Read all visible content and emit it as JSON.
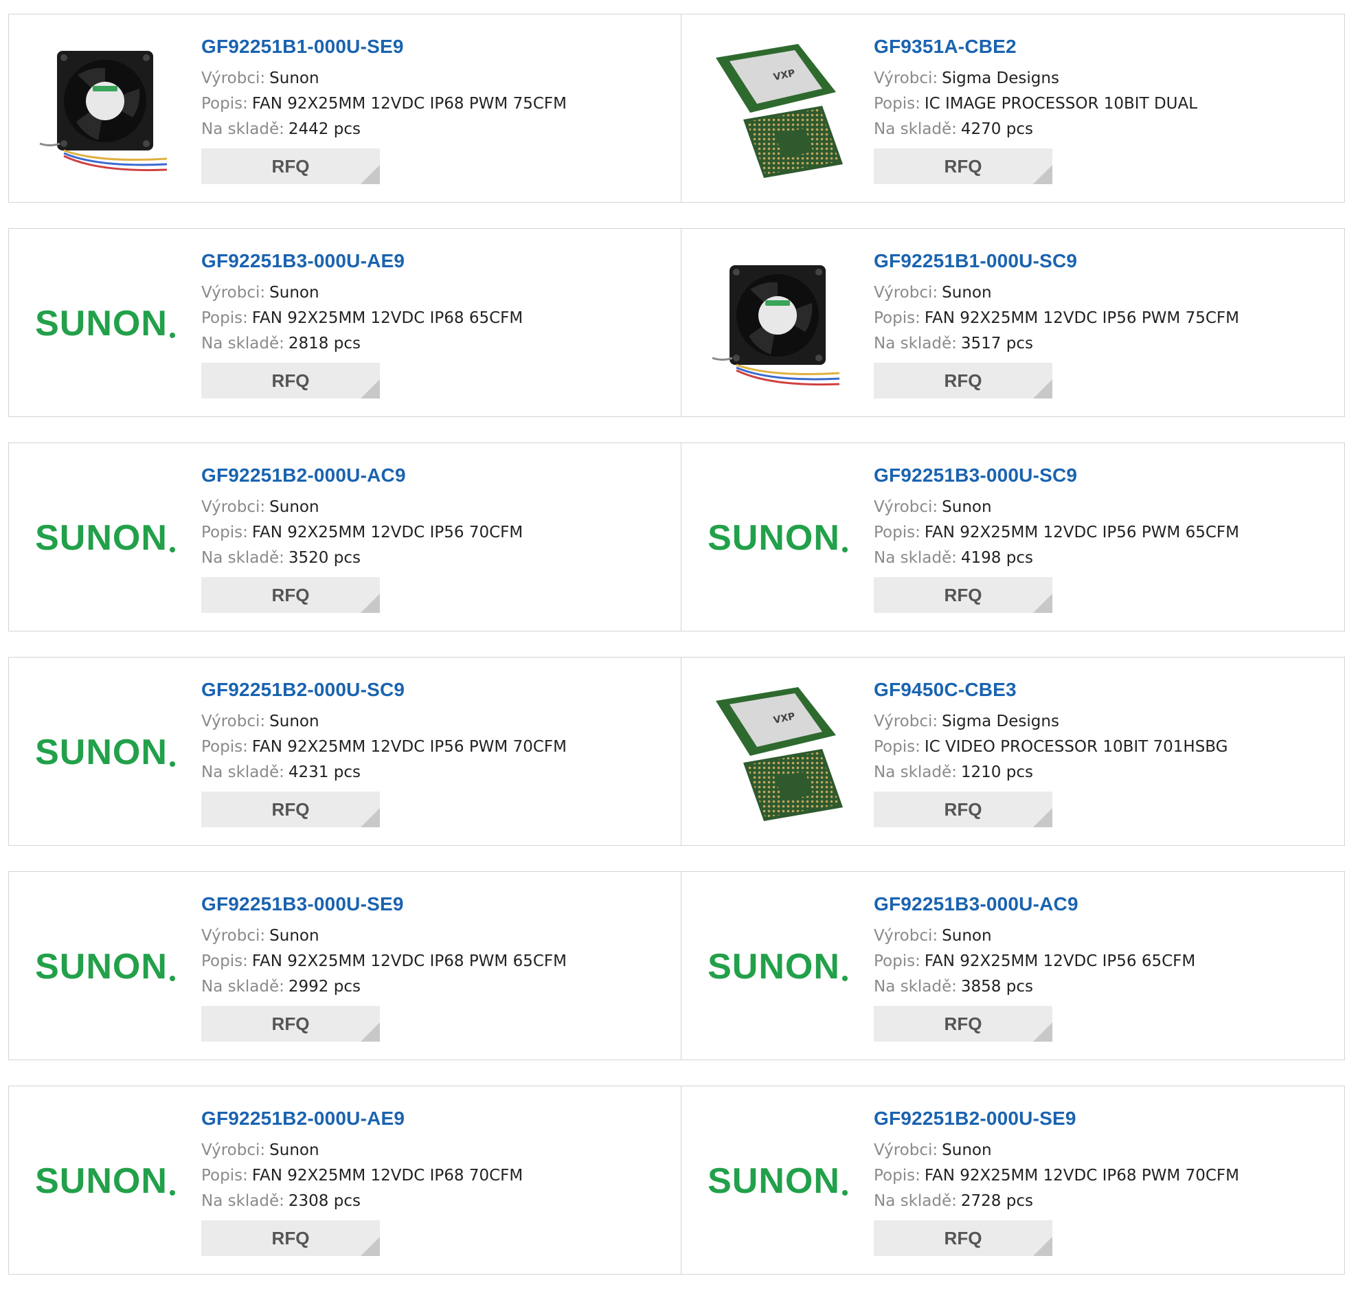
{
  "labels": {
    "manufacturer": "Výrobci:",
    "description": "Popis:",
    "stock": "Na skladě:",
    "rfq": "RFQ"
  },
  "brand_text": "SUNON",
  "products": [
    {
      "part": "GF92251B1-000U-SE9",
      "manufacturer": "Sunon",
      "description": "FAN 92X25MM 12VDC IP68 PWM 75CFM",
      "stock": "2442 pcs",
      "image": "fan"
    },
    {
      "part": "GF9351A-CBE2",
      "manufacturer": "Sigma Designs",
      "description": "IC IMAGE PROCESSOR 10BIT DUAL",
      "stock": "4270 pcs",
      "image": "chip"
    },
    {
      "part": "GF92251B3-000U-AE9",
      "manufacturer": "Sunon",
      "description": "FAN 92X25MM 12VDC IP68 65CFM",
      "stock": "2818 pcs",
      "image": "sunon-logo"
    },
    {
      "part": "GF92251B1-000U-SC9",
      "manufacturer": "Sunon",
      "description": "FAN 92X25MM 12VDC IP56 PWM 75CFM",
      "stock": "3517 pcs",
      "image": "fan"
    },
    {
      "part": "GF92251B2-000U-AC9",
      "manufacturer": "Sunon",
      "description": "FAN 92X25MM 12VDC IP56 70CFM",
      "stock": "3520 pcs",
      "image": "sunon-logo"
    },
    {
      "part": "GF92251B3-000U-SC9",
      "manufacturer": "Sunon",
      "description": "FAN 92X25MM 12VDC IP56 PWM 65CFM",
      "stock": "4198 pcs",
      "image": "sunon-logo"
    },
    {
      "part": "GF92251B2-000U-SC9",
      "manufacturer": "Sunon",
      "description": "FAN 92X25MM 12VDC IP56 PWM 70CFM",
      "stock": "4231 pcs",
      "image": "sunon-logo"
    },
    {
      "part": "GF9450C-CBE3",
      "manufacturer": "Sigma Designs",
      "description": "IC VIDEO PROCESSOR 10BIT 701HSBG",
      "stock": "1210 pcs",
      "image": "chip"
    },
    {
      "part": "GF92251B3-000U-SE9",
      "manufacturer": "Sunon",
      "description": "FAN 92X25MM 12VDC IP68 PWM 65CFM",
      "stock": "2992 pcs",
      "image": "sunon-logo"
    },
    {
      "part": "GF92251B3-000U-AC9",
      "manufacturer": "Sunon",
      "description": "FAN 92X25MM 12VDC IP56 65CFM",
      "stock": "3858 pcs",
      "image": "sunon-logo"
    },
    {
      "part": "GF92251B2-000U-AE9",
      "manufacturer": "Sunon",
      "description": "FAN 92X25MM 12VDC IP68 70CFM",
      "stock": "2308 pcs",
      "image": "sunon-logo"
    },
    {
      "part": "GF92251B2-000U-SE9",
      "manufacturer": "Sunon",
      "description": "FAN 92X25MM 12VDC IP68 PWM 70CFM",
      "stock": "2728 pcs",
      "image": "sunon-logo"
    }
  ]
}
